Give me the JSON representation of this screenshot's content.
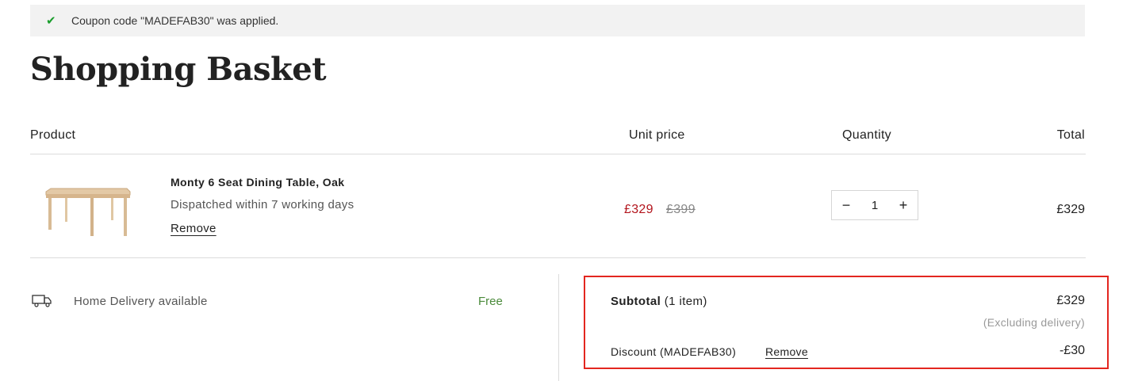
{
  "notice": {
    "icon": "check-icon",
    "message": "Coupon code \"MADEFAB30\" was applied."
  },
  "page": {
    "title": "Shopping Basket"
  },
  "table": {
    "headers": {
      "product": "Product",
      "unit_price": "Unit price",
      "quantity": "Quantity",
      "total": "Total"
    },
    "items": [
      {
        "name": "Monty 6 Seat Dining Table, Oak",
        "dispatch": "Dispatched within 7 working days",
        "remove_label": "Remove",
        "price_now": "£329",
        "price_was": "£399",
        "qty_minus": "−",
        "qty": "1",
        "qty_plus": "+",
        "total": "£329"
      }
    ]
  },
  "delivery": {
    "icon": "truck-icon",
    "label": "Home Delivery available",
    "price": "Free"
  },
  "summary": {
    "subtotal_label": "Subtotal",
    "subtotal_count": "(1 item)",
    "subtotal_value": "£329",
    "excluding": "(Excluding delivery)",
    "discount_label": "Discount (MADEFAB30)",
    "discount_remove": "Remove",
    "discount_value": "-£30"
  },
  "colors": {
    "sale_price": "#b3141c",
    "free": "#4a8a3a",
    "check": "#1a9e2c",
    "highlight_border": "#e3261f"
  }
}
